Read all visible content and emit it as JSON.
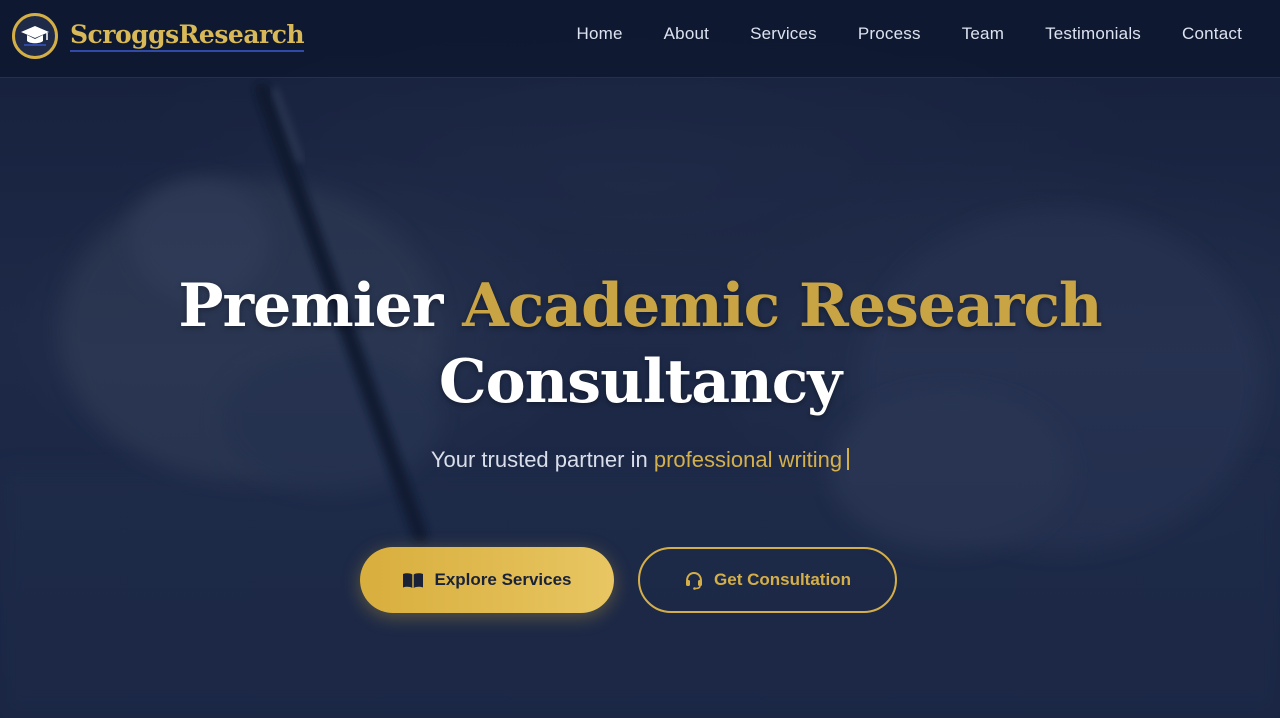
{
  "brand": {
    "name": "ScroggsResearch",
    "logo_icon": "graduation-cap-icon"
  },
  "nav": {
    "items": [
      {
        "label": "Home"
      },
      {
        "label": "About"
      },
      {
        "label": "Services"
      },
      {
        "label": "Process"
      },
      {
        "label": "Team"
      },
      {
        "label": "Testimonials"
      },
      {
        "label": "Contact"
      }
    ]
  },
  "hero": {
    "title_part1": "Premier",
    "title_highlight": "Academic Research",
    "title_part2": "Consultancy",
    "subtitle_prefix": "Your trusted partner in",
    "subtitle_highlight": "professional writing",
    "primary_button": {
      "label": "Explore Services",
      "icon": "book-icon"
    },
    "secondary_button": {
      "label": "Get Consultation",
      "icon": "headset-icon"
    }
  },
  "colors": {
    "accent_gold": "#d4ae48",
    "navy": "#1b2744",
    "text_light": "#dce2ef"
  }
}
